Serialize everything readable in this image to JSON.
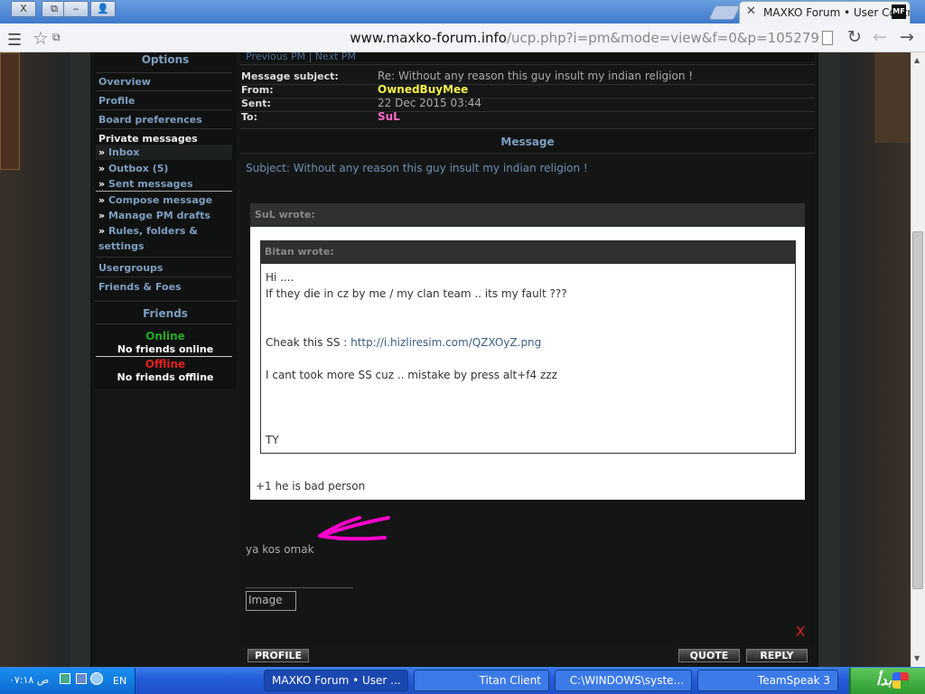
{
  "browser": {
    "tab_title": "MAXKO Forum • User Contro",
    "tab_favicon": "MF",
    "url_host": "www.maxko-forum.info",
    "url_path": "/ucp.php?i=pm&mode=view&f=0&p=105279",
    "window_buttons": [
      "X",
      "⧉",
      "‒",
      "👤"
    ]
  },
  "sidebar": {
    "options_title": "Options",
    "links": [
      "Overview",
      "Profile",
      "Board preferences"
    ],
    "private_messages_title": "Private messages",
    "pm_items": [
      "Inbox",
      "Outbox (5)",
      "Sent messages",
      "Compose message",
      "Manage PM drafts",
      "Rules, folders &",
      "settings"
    ],
    "bottom_links": [
      "Usergroups",
      "Friends & Foes"
    ],
    "friends_title": "Friends",
    "online_label": "Online",
    "online_text": "No friends online",
    "offline_label": "Offline",
    "offline_text": "No friends offline"
  },
  "message": {
    "prev_next": "Previous PM | Next PM",
    "subject_label": "Message subject:",
    "subject_value": "Re: Without any reason this guy insult my indian religion !",
    "from_label": "From:",
    "from_value": "OwnedBuyMee",
    "sent_label": "Sent:",
    "sent_value": "22 Dec 2015 03:44",
    "to_label": "To:",
    "to_value": "SuL",
    "header": "Message",
    "body_subject": "Subject: Without any reason this guy insult my indian religion !",
    "outer_cite": "SuL wrote:",
    "inner_cite": "Bitan wrote:",
    "inner_lines": [
      "Hi ....",
      "If they die in cz by me / my clan team .. its my fault ???"
    ],
    "cheak_prefix": "Cheak this SS : ",
    "cheak_link": "http://i.hizliresim.com/QZXOyZ.png",
    "inner_line_last": "I cant took more SS cuz .. mistake by press alt+f4 zzz",
    "inner_ty": "TY",
    "outer_after": "+1 he is bad person",
    "reply_text": "ya kos omak",
    "image_alt": "Image",
    "x_mark": "X",
    "btn_profile": "PROFILE",
    "btn_quote": "QUOTE",
    "btn_reply": "REPLY"
  },
  "colors": {
    "from_color": "#f5f04a",
    "to_color": "#ff66cc",
    "online_color": "#22aa22",
    "offline_color": "#e02020",
    "arrow_color": "#ff00cc"
  },
  "taskbar": {
    "clock": "۰۷:۱۸ ص",
    "lang": "EN",
    "tasks": [
      "MAXKO Forum • User ...",
      "Titan Client",
      "C:\\WINDOWS\\syste...",
      "TeamSpeak 3"
    ],
    "start_label": "ابدأ"
  }
}
